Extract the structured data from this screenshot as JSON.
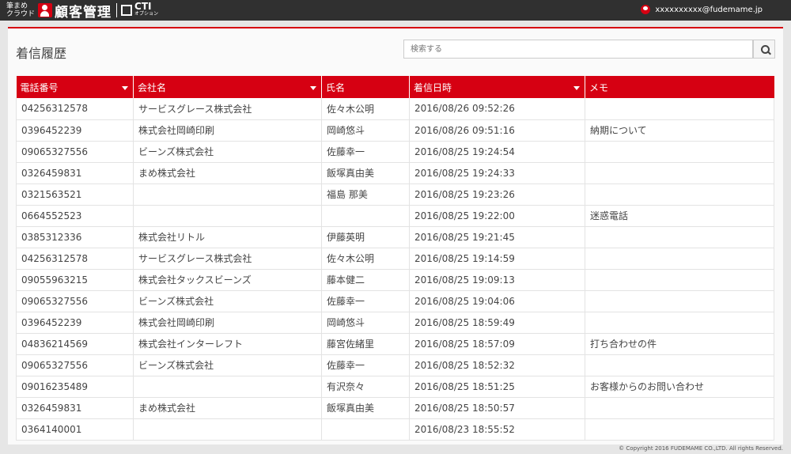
{
  "header": {
    "logo_small": "筆まめ\nクラウド",
    "logo_main": "顧客管理",
    "logo_cti": "CTI",
    "logo_cti_sub": "オプション",
    "user_email": "xxxxxxxxxx@fudemame.jp"
  },
  "page": {
    "title": "着信履歴",
    "search_placeholder": "検索する"
  },
  "table": {
    "columns": [
      "電話番号",
      "会社名",
      "氏名",
      "着信日時",
      "メモ"
    ],
    "rows": [
      [
        "04256312578",
        "サービスグレース株式会社",
        "佐々木公明",
        "2016/08/26 09:52:26",
        ""
      ],
      [
        "0396452239",
        "株式会社岡崎印刷",
        "岡崎悠斗",
        "2016/08/26 09:51:16",
        "納期について"
      ],
      [
        "09065327556",
        "ビーンズ株式会社",
        "佐藤幸一",
        "2016/08/25 19:24:54",
        ""
      ],
      [
        "0326459831",
        "まめ株式会社",
        "飯塚真由美",
        "2016/08/25 19:24:33",
        ""
      ],
      [
        "0321563521",
        "",
        "福島 那美",
        "2016/08/25 19:23:26",
        ""
      ],
      [
        "0664552523",
        "",
        "",
        "2016/08/25 19:22:00",
        "迷惑電話"
      ],
      [
        "0385312336",
        "株式会社リトル",
        "伊藤英明",
        "2016/08/25 19:21:45",
        ""
      ],
      [
        "04256312578",
        "サービスグレース株式会社",
        "佐々木公明",
        "2016/08/25 19:14:59",
        ""
      ],
      [
        "09055963215",
        "株式会社タックスビーンズ",
        "藤本健二",
        "2016/08/25 19:09:13",
        ""
      ],
      [
        "09065327556",
        "ビーンズ株式会社",
        "佐藤幸一",
        "2016/08/25 19:04:06",
        ""
      ],
      [
        "0396452239",
        "株式会社岡崎印刷",
        "岡崎悠斗",
        "2016/08/25 18:59:49",
        ""
      ],
      [
        "04836214569",
        "株式会社インターレフト",
        "藤宮佐緒里",
        "2016/08/25 18:57:09",
        "打ち合わせの件"
      ],
      [
        "09065327556",
        "ビーンズ株式会社",
        "佐藤幸一",
        "2016/08/25 18:52:32",
        ""
      ],
      [
        "09016235489",
        "",
        "有沢奈々",
        "2016/08/25 18:51:25",
        "お客様からのお問い合わせ"
      ],
      [
        "0326459831",
        "まめ株式会社",
        "飯塚真由美",
        "2016/08/25 18:50:57",
        ""
      ],
      [
        "0364140001",
        "",
        "",
        "2016/08/23 18:55:52",
        ""
      ]
    ]
  },
  "footer": {
    "copyright": "© Copyright 2016 FUDEMAME CO.,LTD. All rights Reserved."
  },
  "colors": {
    "accent": "#d60012",
    "header_bg": "#303030"
  }
}
